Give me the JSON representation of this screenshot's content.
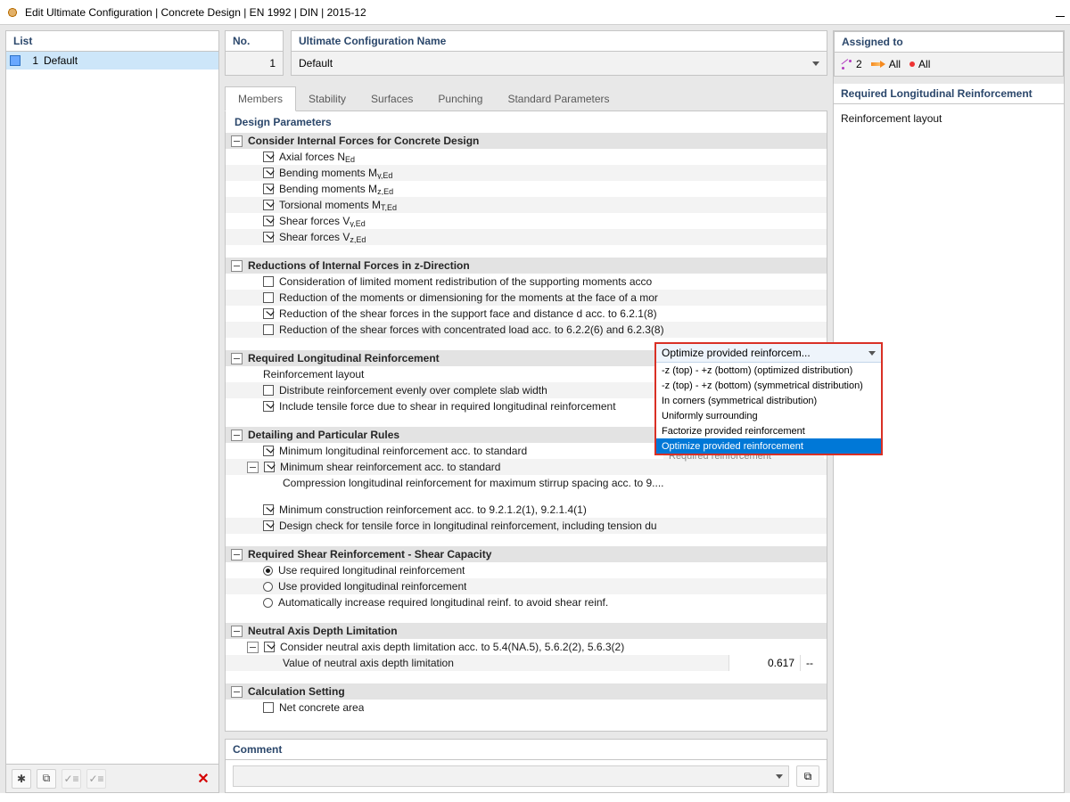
{
  "window": {
    "title": "Edit Ultimate Configuration | Concrete Design | EN 1992 | DIN | 2015-12"
  },
  "left": {
    "header": "List",
    "item_num": "1",
    "item_name": "Default"
  },
  "no": {
    "header": "No.",
    "value": "1"
  },
  "name": {
    "header": "Ultimate Configuration Name",
    "value": "Default"
  },
  "assigned": {
    "header": "Assigned to",
    "chip1": "2",
    "chip2": "All",
    "chip3": "All"
  },
  "tabs": {
    "members": "Members",
    "stability": "Stability",
    "surfaces": "Surfaces",
    "punching": "Punching",
    "std": "Standard Parameters"
  },
  "dp": {
    "title": "Design Parameters",
    "g1": "Consider Internal Forces for Concrete Design",
    "g1_axial_a": "Axial forces N",
    "g1_axial_b": "Ed",
    "g1_bmy_a": "Bending moments M",
    "g1_bmy_b": "y,Ed",
    "g1_bmz_a": "Bending moments M",
    "g1_bmz_b": "z,Ed",
    "g1_tor_a": "Torsional moments M",
    "g1_tor_b": "T,Ed",
    "g1_svy_a": "Shear forces V",
    "g1_svy_b": "y,Ed",
    "g1_svz_a": "Shear forces V",
    "g1_svz_b": "z,Ed",
    "g2": "Reductions of Internal Forces in z-Direction",
    "g2_r1": "Consideration of limited moment redistribution of the supporting moments acco",
    "g2_r2": "Reduction of the moments or dimensioning for the moments at the face of a mor",
    "g2_r3": "Reduction of the shear forces in the support face and distance d acc. to 6.2.1(8)",
    "g2_r4": "Reduction of the shear forces with concentrated load acc. to 6.2.2(6) and 6.2.3(8)",
    "g3": "Required Longitudinal Reinforcement",
    "g3_rlayout": "Reinforcement layout",
    "g3_dist": "Distribute reinforcement evenly over complete slab width",
    "g3_tens": "Include tensile force due to shear in required longitudinal reinforcement",
    "g4": "Detailing and Particular Rules",
    "g4_r1": "Minimum longitudinal reinforcement acc. to standard",
    "g4_r2": "Minimum shear reinforcement acc. to standard",
    "g4_r2s": "Compression longitudinal reinforcement for maximum stirrup spacing acc. to 9....",
    "g4_r3": "Minimum construction reinforcement acc. to 9.2.1.2(1), 9.2.1.4(1)",
    "g4_r4": "Design check for tensile force in longitudinal reinforcement, including tension du",
    "g5": "Required Shear Reinforcement - Shear Capacity",
    "g5_r1": "Use required longitudinal reinforcement",
    "g5_r2": "Use provided longitudinal reinforcement",
    "g5_r3": "Automatically increase required longitudinal reinf. to avoid shear reinf.",
    "g6": "Neutral Axis Depth Limitation",
    "g6_r1": "Consider neutral axis depth limitation acc. to 5.4(NA.5), 5.6.2(2), 5.6.3(2)",
    "g6_r2": "Value of neutral axis depth limitation",
    "g6_val": "0.617",
    "g6_unit": "--",
    "g7": "Calculation Setting",
    "g7_r1": "Net concrete area",
    "faint": "Required reinforcement"
  },
  "dd": {
    "selected": "Optimize provided reinforcem...",
    "opt1": "-z (top) - +z (bottom) (optimized distribution)",
    "opt2": "-z (top) - +z (bottom) (symmetrical distribution)",
    "opt3": "In corners (symmetrical distribution)",
    "opt4": "Uniformly surrounding",
    "opt5": "Factorize provided reinforcement",
    "opt6": "Optimize provided reinforcement"
  },
  "right": {
    "header": "Required Longitudinal Reinforcement",
    "line1": "Reinforcement layout"
  },
  "comment": {
    "header": "Comment"
  }
}
